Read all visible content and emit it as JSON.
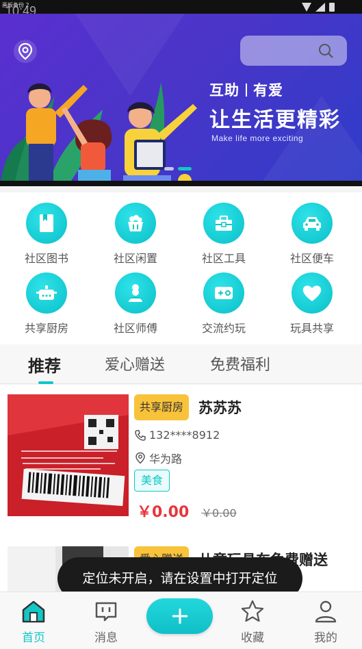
{
  "status_bar": {
    "label": "画板备份 2",
    "time": "10:49"
  },
  "banner": {
    "search_placeholder": "",
    "heading_left": "互助",
    "heading_right": "有爱",
    "headline": "让生活更精彩",
    "subtitle": "Make life more exciting",
    "slide_count": 2,
    "active_slide": 1
  },
  "categories": [
    {
      "label": "社区图书",
      "icon": "book-icon"
    },
    {
      "label": "社区闲置",
      "icon": "basket-icon"
    },
    {
      "label": "社区工具",
      "icon": "toolbox-icon"
    },
    {
      "label": "社区便车",
      "icon": "car-icon"
    },
    {
      "label": "共享厨房",
      "icon": "pot-icon"
    },
    {
      "label": "社区师傅",
      "icon": "chef-icon"
    },
    {
      "label": "交流约玩",
      "icon": "game-icon"
    },
    {
      "label": "玩具共享",
      "icon": "heart-icon"
    }
  ],
  "tabs": [
    {
      "label": "推荐",
      "active": true
    },
    {
      "label": "爱心赠送",
      "active": false
    },
    {
      "label": "免费福利",
      "active": false
    }
  ],
  "items": [
    {
      "tag": "共享厨房",
      "title": "苏苏苏",
      "phone": "132****8912",
      "location": "华为路",
      "chip": "美食",
      "price": "￥0.00",
      "old_price": "￥0.00"
    },
    {
      "tag": "爱心赠送",
      "title": "儿童玩具车免费赠送"
    }
  ],
  "toast": "定位未开启，请在设置中打开定位",
  "bottom_nav": [
    {
      "label": "首页",
      "icon": "home-icon",
      "active": true
    },
    {
      "label": "消息",
      "icon": "message-icon",
      "active": false
    },
    {
      "label": "",
      "icon": "plus-icon",
      "active": false
    },
    {
      "label": "收藏",
      "icon": "star-icon",
      "active": false
    },
    {
      "label": "我的",
      "icon": "user-icon",
      "active": false
    }
  ],
  "colors": {
    "accent": "#12c7c6",
    "banner": "#4a35c8",
    "tag": "#f8c33a",
    "price": "#e8363c"
  }
}
